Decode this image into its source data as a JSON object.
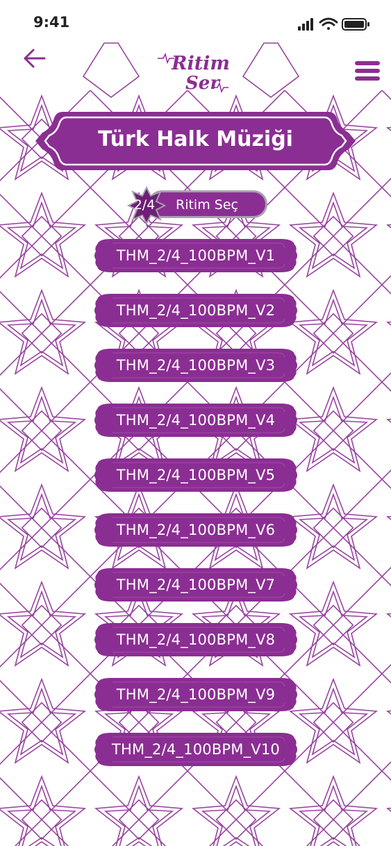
{
  "status_bar": {
    "time": "9:41"
  },
  "header": {
    "logo_line1": "Ritim",
    "logo_line2": "Ser"
  },
  "banner": {
    "title": "Türk Halk Müziği"
  },
  "selector": {
    "time_signature": "2/4",
    "label": "Ritim Seç"
  },
  "rhythms": [
    "THM_2/4_100BPM_V1",
    "THM_2/4_100BPM_V2",
    "THM_2/4_100BPM_V3",
    "THM_2/4_100BPM_V4",
    "THM_2/4_100BPM_V5",
    "THM_2/4_100BPM_V6",
    "THM_2/4_100BPM_V7",
    "THM_2/4_100BPM_V8",
    "THM_2/4_100BPM_V9",
    "THM_2/4_100BPM_V10"
  ],
  "colors": {
    "brand": "#8b2e93",
    "brand_dark": "#6e1f77",
    "pattern": "#8b2e93"
  }
}
